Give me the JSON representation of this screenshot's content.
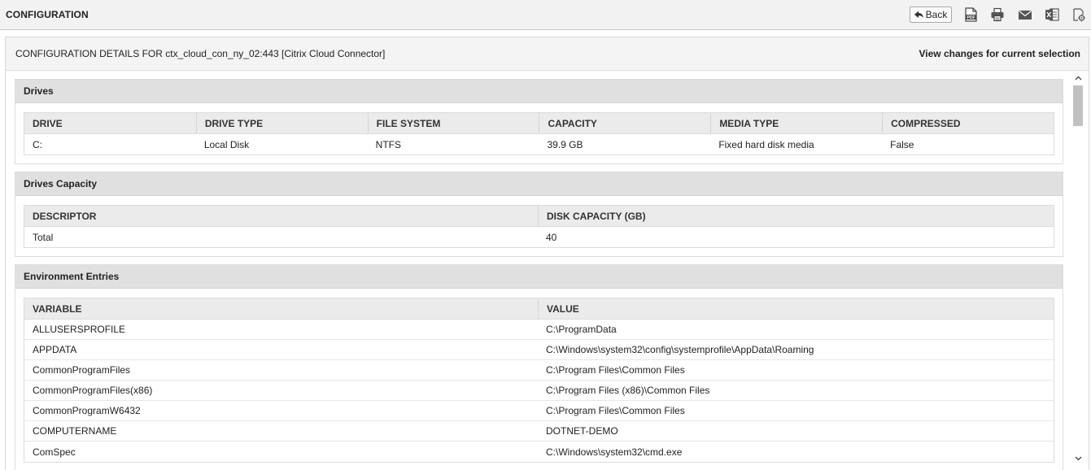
{
  "topbar": {
    "title": "CONFIGURATION",
    "back_label": "Back",
    "tools": [
      {
        "name": "pdf-icon"
      },
      {
        "name": "print-icon"
      },
      {
        "name": "mail-icon"
      },
      {
        "name": "excel-icon"
      },
      {
        "name": "settings-icon"
      }
    ]
  },
  "panel": {
    "title": "CONFIGURATION DETAILS FOR ctx_cloud_con_ny_02:443 [Citrix Cloud Connector]",
    "link": "View changes for current selection"
  },
  "drives": {
    "title": "Drives",
    "columns": [
      "DRIVE",
      "DRIVE TYPE",
      "FILE SYSTEM",
      "CAPACITY",
      "MEDIA TYPE",
      "COMPRESSED"
    ],
    "rows": [
      [
        "C:",
        "Local Disk",
        "NTFS",
        "39.9 GB",
        "Fixed hard disk media",
        "False"
      ]
    ]
  },
  "drives_capacity": {
    "title": "Drives Capacity",
    "columns": [
      "DESCRIPTOR",
      "DISK CAPACITY (GB)"
    ],
    "rows": [
      [
        "Total",
        "40"
      ]
    ]
  },
  "environment": {
    "title": "Environment Entries",
    "columns": [
      "VARIABLE",
      "VALUE"
    ],
    "rows": [
      [
        "ALLUSERSPROFILE",
        "C:\\ProgramData"
      ],
      [
        "APPDATA",
        "C:\\Windows\\system32\\config\\systemprofile\\AppData\\Roaming"
      ],
      [
        "CommonProgramFiles",
        "C:\\Program Files\\Common Files"
      ],
      [
        "CommonProgramFiles(x86)",
        "C:\\Program Files (x86)\\Common Files"
      ],
      [
        "CommonProgramW6432",
        "C:\\Program Files\\Common Files"
      ],
      [
        "COMPUTERNAME",
        "DOTNET-DEMO"
      ],
      [
        "ComSpec",
        "C:\\Windows\\system32\\cmd.exe"
      ]
    ]
  }
}
